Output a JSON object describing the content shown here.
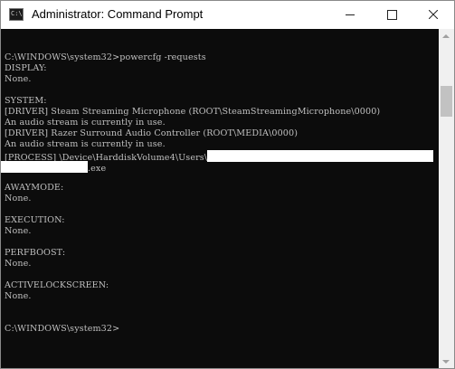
{
  "window": {
    "title": "Administrator: Command Prompt",
    "icon_name": "cmd-icon",
    "icon_glyph": "C:\\",
    "controls": {
      "minimize": "minimize-icon",
      "maximize": "maximize-icon",
      "close": "close-icon"
    }
  },
  "console": {
    "background": "#0c0c0c",
    "foreground": "#c0c0c0",
    "lines": [
      "C:\\WINDOWS\\system32>powercfg -requests",
      "DISPLAY:",
      "None.",
      "",
      "SYSTEM:",
      "[DRIVER] Steam Streaming Microphone (ROOT\\SteamStreamingMicrophone\\0000)",
      "An audio stream is currently in use.",
      "[DRIVER] Razer Surround Audio Controller (ROOT\\MEDIA\\0000)",
      "An audio stream is currently in use.",
      "[PROCESS] \\Device\\HarddiskVolume4\\Users\\",
      ".exe",
      "",
      "AWAYMODE:",
      "None.",
      "",
      "EXECUTION:",
      "None.",
      "",
      "PERFBOOST:",
      "None.",
      "",
      "ACTIVELOCKSCREEN:",
      "None.",
      "",
      "",
      "C:\\WINDOWS\\system32>"
    ]
  },
  "scrollbar": {
    "position_fraction": 0.17
  }
}
